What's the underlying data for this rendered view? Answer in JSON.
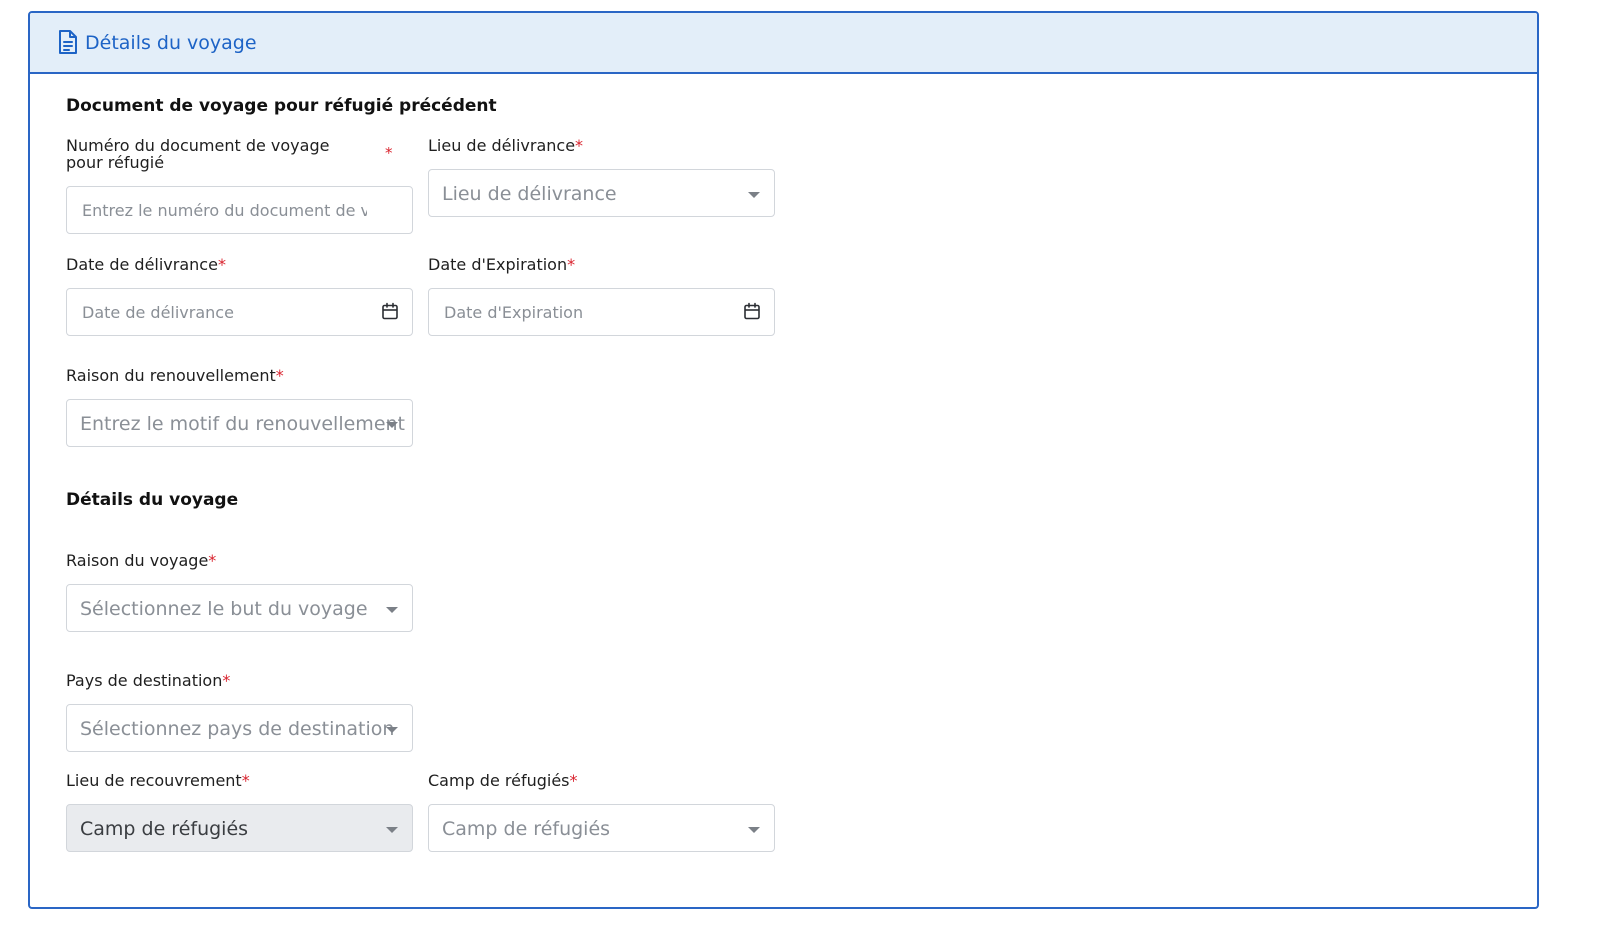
{
  "header": {
    "title": "Détails du voyage",
    "icon": "document-icon",
    "accent_color": "#2a66c5",
    "background_color": "#e3eef9"
  },
  "sections": {
    "previous_document": {
      "title": "Document de voyage pour réfugié précédent"
    },
    "travel": {
      "title": "Détails du voyage"
    }
  },
  "fields": {
    "doc_number": {
      "label": "Numéro du document de voyage pour réfugié",
      "required_marker": "*",
      "placeholder": "Entrez le numéro du document de voyage",
      "value": ""
    },
    "issue_place": {
      "label": "Lieu de délivrance",
      "required_marker": "*",
      "placeholder": "Lieu de délivrance"
    },
    "issue_date": {
      "label": "Date de délivrance",
      "required_marker": "*",
      "placeholder": "Date de délivrance",
      "icon": "calendar-icon"
    },
    "expiry_date": {
      "label": "Date d'Expiration",
      "required_marker": "*",
      "placeholder": "Date d'Expiration",
      "icon": "calendar-icon"
    },
    "renewal_reason": {
      "label": "Raison du renouvellement",
      "required_marker": "*",
      "placeholder": "Entrez le motif du renouvellement"
    },
    "travel_reason": {
      "label": "Raison du voyage",
      "required_marker": "*",
      "placeholder": "Sélectionnez le but du voyage"
    },
    "destination_country": {
      "label": "Pays de destination",
      "required_marker": "*",
      "placeholder": "Sélectionnez pays de destination"
    },
    "collection_place": {
      "label": "Lieu de recouvrement",
      "required_marker": "*",
      "value": "Camp de réfugiés",
      "disabled": true
    },
    "refugee_camp": {
      "label": "Camp de réfugiés",
      "required_marker": "*",
      "placeholder": "Camp de réfugiés"
    }
  },
  "colors": {
    "required": "#d9232e",
    "placeholder": "#8a8f96",
    "disabled_background": "#e9ebee"
  }
}
